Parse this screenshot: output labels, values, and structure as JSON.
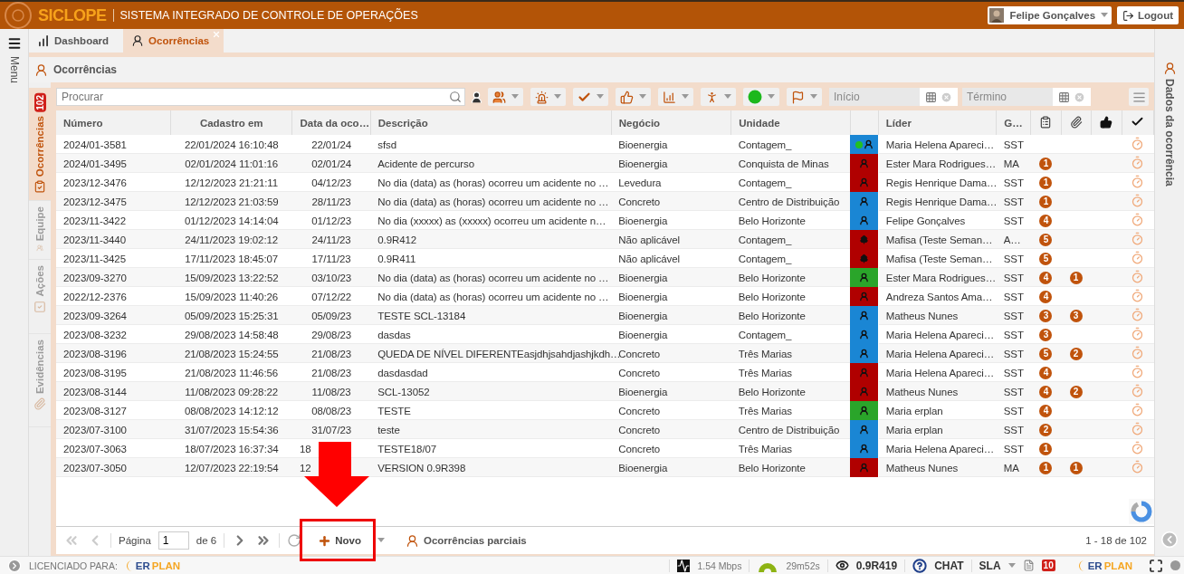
{
  "header": {
    "logo": "SICLOPE",
    "title": "SISTEMA INTEGRADO DE CONTROLE DE OPERAÇÕES",
    "user": "Felipe Gonçalves",
    "logout": "Logout"
  },
  "menu": {
    "label": "Menu"
  },
  "tabs": [
    {
      "label": "Dashboard",
      "kind": "chart",
      "selected": false,
      "closable": false
    },
    {
      "label": "Ocorrências",
      "kind": "person",
      "selected": true,
      "closable": true
    }
  ],
  "page_title": "Ocorrências",
  "side_tabs": [
    {
      "label": "Ocorrências",
      "kind": "report",
      "badge": "102",
      "selected": true
    },
    {
      "label": "Equipe",
      "kind": "team",
      "selected": false
    },
    {
      "label": "Ações",
      "kind": "actions",
      "selected": false
    },
    {
      "label": "Evidências",
      "kind": "clip",
      "selected": false
    }
  ],
  "toolbar": {
    "search": {
      "placeholder": "Procurar"
    },
    "filters": [
      {
        "kind": "avatar",
        "dropdown": false
      },
      {
        "kind": "group",
        "dropdown": true
      },
      {
        "kind": "siren",
        "dropdown": true
      },
      {
        "kind": "check",
        "dropdown": true
      },
      {
        "kind": "thumbs",
        "dropdown": true
      },
      {
        "kind": "chart",
        "dropdown": true
      },
      {
        "kind": "fall",
        "dropdown": true
      },
      {
        "kind": "status",
        "dropdown": true
      },
      {
        "kind": "flag",
        "dropdown": true
      }
    ],
    "dates": [
      {
        "placeholder": "Início"
      },
      {
        "placeholder": "Término"
      }
    ]
  },
  "table": {
    "columns": [
      {
        "kind": "text",
        "label": "Número"
      },
      {
        "kind": "text",
        "label": "Cadastro em"
      },
      {
        "kind": "text",
        "label": "Data da oco…"
      },
      {
        "kind": "text",
        "label": "Descrição"
      },
      {
        "kind": "text",
        "label": "Negócio"
      },
      {
        "kind": "text",
        "label": "Unidade"
      },
      {
        "kind": "blank"
      },
      {
        "kind": "text",
        "label": "Líder"
      },
      {
        "kind": "text",
        "label": "G…"
      },
      {
        "kind": "clipboard"
      },
      {
        "kind": "paperclip"
      },
      {
        "kind": "thumbs"
      },
      {
        "kind": "check"
      }
    ],
    "rows": [
      {
        "numero": "2024/01-3581",
        "cadastro": "22/01/2024 16:10:48",
        "data": "22/01/24",
        "descricao": "sfsd",
        "negocio": "Bioenergia",
        "unidade": "Contagem_",
        "color": "#1a86d4",
        "kind": "person",
        "dot": true,
        "lider": "Maria Helena Apareci…",
        "g": "SST"
      },
      {
        "numero": "2024/01-3495",
        "cadastro": "02/01/2024 11:01:16",
        "data": "02/01/24",
        "descricao": "Acidente de percurso",
        "negocio": "Bioenergia",
        "unidade": "Conquista de Minas",
        "color": "#b00000",
        "kind": "person",
        "dot": false,
        "lider": "Ester Mara Rodrigues…",
        "g": "MA",
        "count_1": "1"
      },
      {
        "numero": "2023/12-3476",
        "cadastro": "12/12/2023 21:21:11",
        "data": "04/12/23",
        "descricao": "No dia (data) as (horas) ocorreu um acidente no …",
        "negocio": "Levedura",
        "unidade": "Contagem_",
        "color": "#b00000",
        "kind": "person",
        "dot": false,
        "lider": "Regis Henrique Dama…",
        "g": "SST",
        "count_1": "1"
      },
      {
        "numero": "2023/12-3475",
        "cadastro": "12/12/2023 21:03:59",
        "data": "28/11/23",
        "descricao": "No dia (data) as (horas) ocorreu um acidente no …",
        "negocio": "Concreto",
        "unidade": "Centro de Distribuição",
        "color": "#1a86d4",
        "kind": "person",
        "dot": false,
        "lider": "Regis Henrique Dama…",
        "g": "SST",
        "count_1": "1"
      },
      {
        "numero": "2023/11-3422",
        "cadastro": "01/12/2023 14:14:04",
        "data": "01/12/23",
        "descricao": "No dia (xxxxx) as (xxxxx) ocorreu um acidente n…",
        "negocio": "Bioenergia",
        "unidade": "Belo Horizonte",
        "color": "#1a86d4",
        "kind": "person",
        "dot": false,
        "lider": "Felipe Gonçalves",
        "g": "SST",
        "count_1": "4"
      },
      {
        "numero": "2023/11-3440",
        "cadastro": "24/11/2023 19:02:12",
        "data": "24/11/23",
        "descricao": "0.9R412",
        "negocio": "Não aplicável",
        "unidade": "Contagem_",
        "color": "#b00000",
        "kind": "tree",
        "dot": false,
        "lider": "Mafisa (Teste Seman…",
        "g": "A…",
        "count_1": "5"
      },
      {
        "numero": "2023/11-3425",
        "cadastro": "17/11/2023 18:45:07",
        "data": "17/11/23",
        "descricao": "0.9R411",
        "negocio": "Não aplicável",
        "unidade": "Contagem_",
        "color": "#b00000",
        "kind": "tree",
        "dot": false,
        "lider": "Mafisa (Teste Seman…",
        "g": "SST",
        "count_1": "5"
      },
      {
        "numero": "2023/09-3270",
        "cadastro": "15/09/2023 13:22:52",
        "data": "03/10/23",
        "descricao": "No dia (data) as (horas) ocorreu um acidente no …",
        "negocio": "Bioenergia",
        "unidade": "Belo Horizonte",
        "color": "#2aa52a",
        "kind": "person",
        "dot": false,
        "lider": "Ester Mara Rodrigues…",
        "g": "SST",
        "count_1": "4",
        "count_2": "1"
      },
      {
        "numero": "2022/12-2376",
        "cadastro": "15/09/2023 11:40:26",
        "data": "07/12/22",
        "descricao": "No dia (data) as (horas) ocorreu um acidente no …",
        "negocio": "Bioenergia",
        "unidade": "Belo Horizonte",
        "color": "#b00000",
        "kind": "person",
        "dot": false,
        "lider": "Andreza Santos Ama…",
        "g": "SST",
        "count_1": "4"
      },
      {
        "numero": "2023/09-3264",
        "cadastro": "05/09/2023 15:25:31",
        "data": "05/09/23",
        "descricao": "TESTE SCL-13184",
        "negocio": "Bioenergia",
        "unidade": "Belo Horizonte",
        "color": "#1a86d4",
        "kind": "person",
        "dot": false,
        "lider": "Matheus Nunes",
        "g": "SST",
        "count_1": "3",
        "count_2": "3"
      },
      {
        "numero": "2023/08-3232",
        "cadastro": "29/08/2023 14:58:48",
        "data": "29/08/23",
        "descricao": "dasdas",
        "negocio": "Bioenergia",
        "unidade": "Contagem_",
        "color": "#1a86d4",
        "kind": "person",
        "dot": false,
        "lider": "Maria Helena Apareci…",
        "g": "SST",
        "count_1": "3"
      },
      {
        "numero": "2023/08-3196",
        "cadastro": "21/08/2023 15:24:55",
        "data": "21/08/23",
        "descricao": "QUEDA DE NÍVEL DIFERENTEasjdhjsahdjashjkdh…",
        "negocio": "Concreto",
        "unidade": "Três Marias",
        "color": "#1a86d4",
        "kind": "person",
        "dot": false,
        "lider": "Maria Helena Apareci…",
        "g": "SST",
        "count_1": "5",
        "count_2": "2"
      },
      {
        "numero": "2023/08-3195",
        "cadastro": "21/08/2023 11:46:56",
        "data": "21/08/23",
        "descricao": "dasdasdad",
        "negocio": "Concreto",
        "unidade": "Três Marias",
        "color": "#b00000",
        "kind": "person",
        "dot": false,
        "lider": "Maria Helena Apareci…",
        "g": "SST",
        "count_1": "4"
      },
      {
        "numero": "2023/08-3144",
        "cadastro": "11/08/2023 09:28:22",
        "data": "11/08/23",
        "descricao": "SCL-13052",
        "negocio": "Bioenergia",
        "unidade": "Belo Horizonte",
        "color": "#b00000",
        "kind": "person",
        "dot": false,
        "lider": "Matheus Nunes",
        "g": "SST",
        "count_1": "4",
        "count_2": "2"
      },
      {
        "numero": "2023/08-3127",
        "cadastro": "08/08/2023 14:12:12",
        "data": "08/08/23",
        "descricao": "TESTE",
        "negocio": "Concreto",
        "unidade": "Três Marias",
        "color": "#2aa52a",
        "kind": "person",
        "dot": false,
        "lider": "Maria erplan",
        "g": "SST",
        "count_1": "4"
      },
      {
        "numero": "2023/07-3100",
        "cadastro": "31/07/2023 15:54:36",
        "data": "31/07/23",
        "descricao": "teste",
        "negocio": "Concreto",
        "unidade": "Centro de Distribuição",
        "color": "#1a86d4",
        "kind": "person",
        "dot": false,
        "lider": "Maria erplan",
        "g": "SST",
        "count_1": "2"
      },
      {
        "numero": "2023/07-3063",
        "cadastro": "18/07/2023 16:37:34",
        "data": "18",
        "descricao": "TESTE18/07",
        "negocio": "Concreto",
        "unidade": "Três Marias",
        "color": "#1a86d4",
        "kind": "person",
        "dot": false,
        "lider": "Maria Helena Apareci…",
        "g": "SST",
        "count_1": "1"
      },
      {
        "numero": "2023/07-3050",
        "cadastro": "12/07/2023 22:19:54",
        "data": "12",
        "descricao": "VERSION 0.9R398",
        "negocio": "Bioenergia",
        "unidade": "Belo Horizonte",
        "color": "#b00000",
        "kind": "person",
        "dot": false,
        "lider": "Matheus Nunes",
        "g": "MA",
        "count_1": "1",
        "count_2": "1"
      }
    ]
  },
  "pager": {
    "page_label": "Página",
    "page": "1",
    "of": "de 6",
    "new_button": "Novo",
    "partial": "Ocorrências parciais",
    "range": "1 - 18 de 102"
  },
  "right_panel": {
    "label": "Dados da ocorrência"
  },
  "status_bar": {
    "licensed": "LICENCIADO PARA:",
    "brand": [
      "ER",
      "PLAN"
    ],
    "speed": "1.54 Mbps",
    "session": "29m52s",
    "version": "0.9R419",
    "chat": "CHAT",
    "sla": "SLA",
    "alerts": "10",
    "brand_right": [
      "ER",
      "PLAN"
    ]
  },
  "annotation": {
    "arrow": true,
    "highlight_box": true
  }
}
